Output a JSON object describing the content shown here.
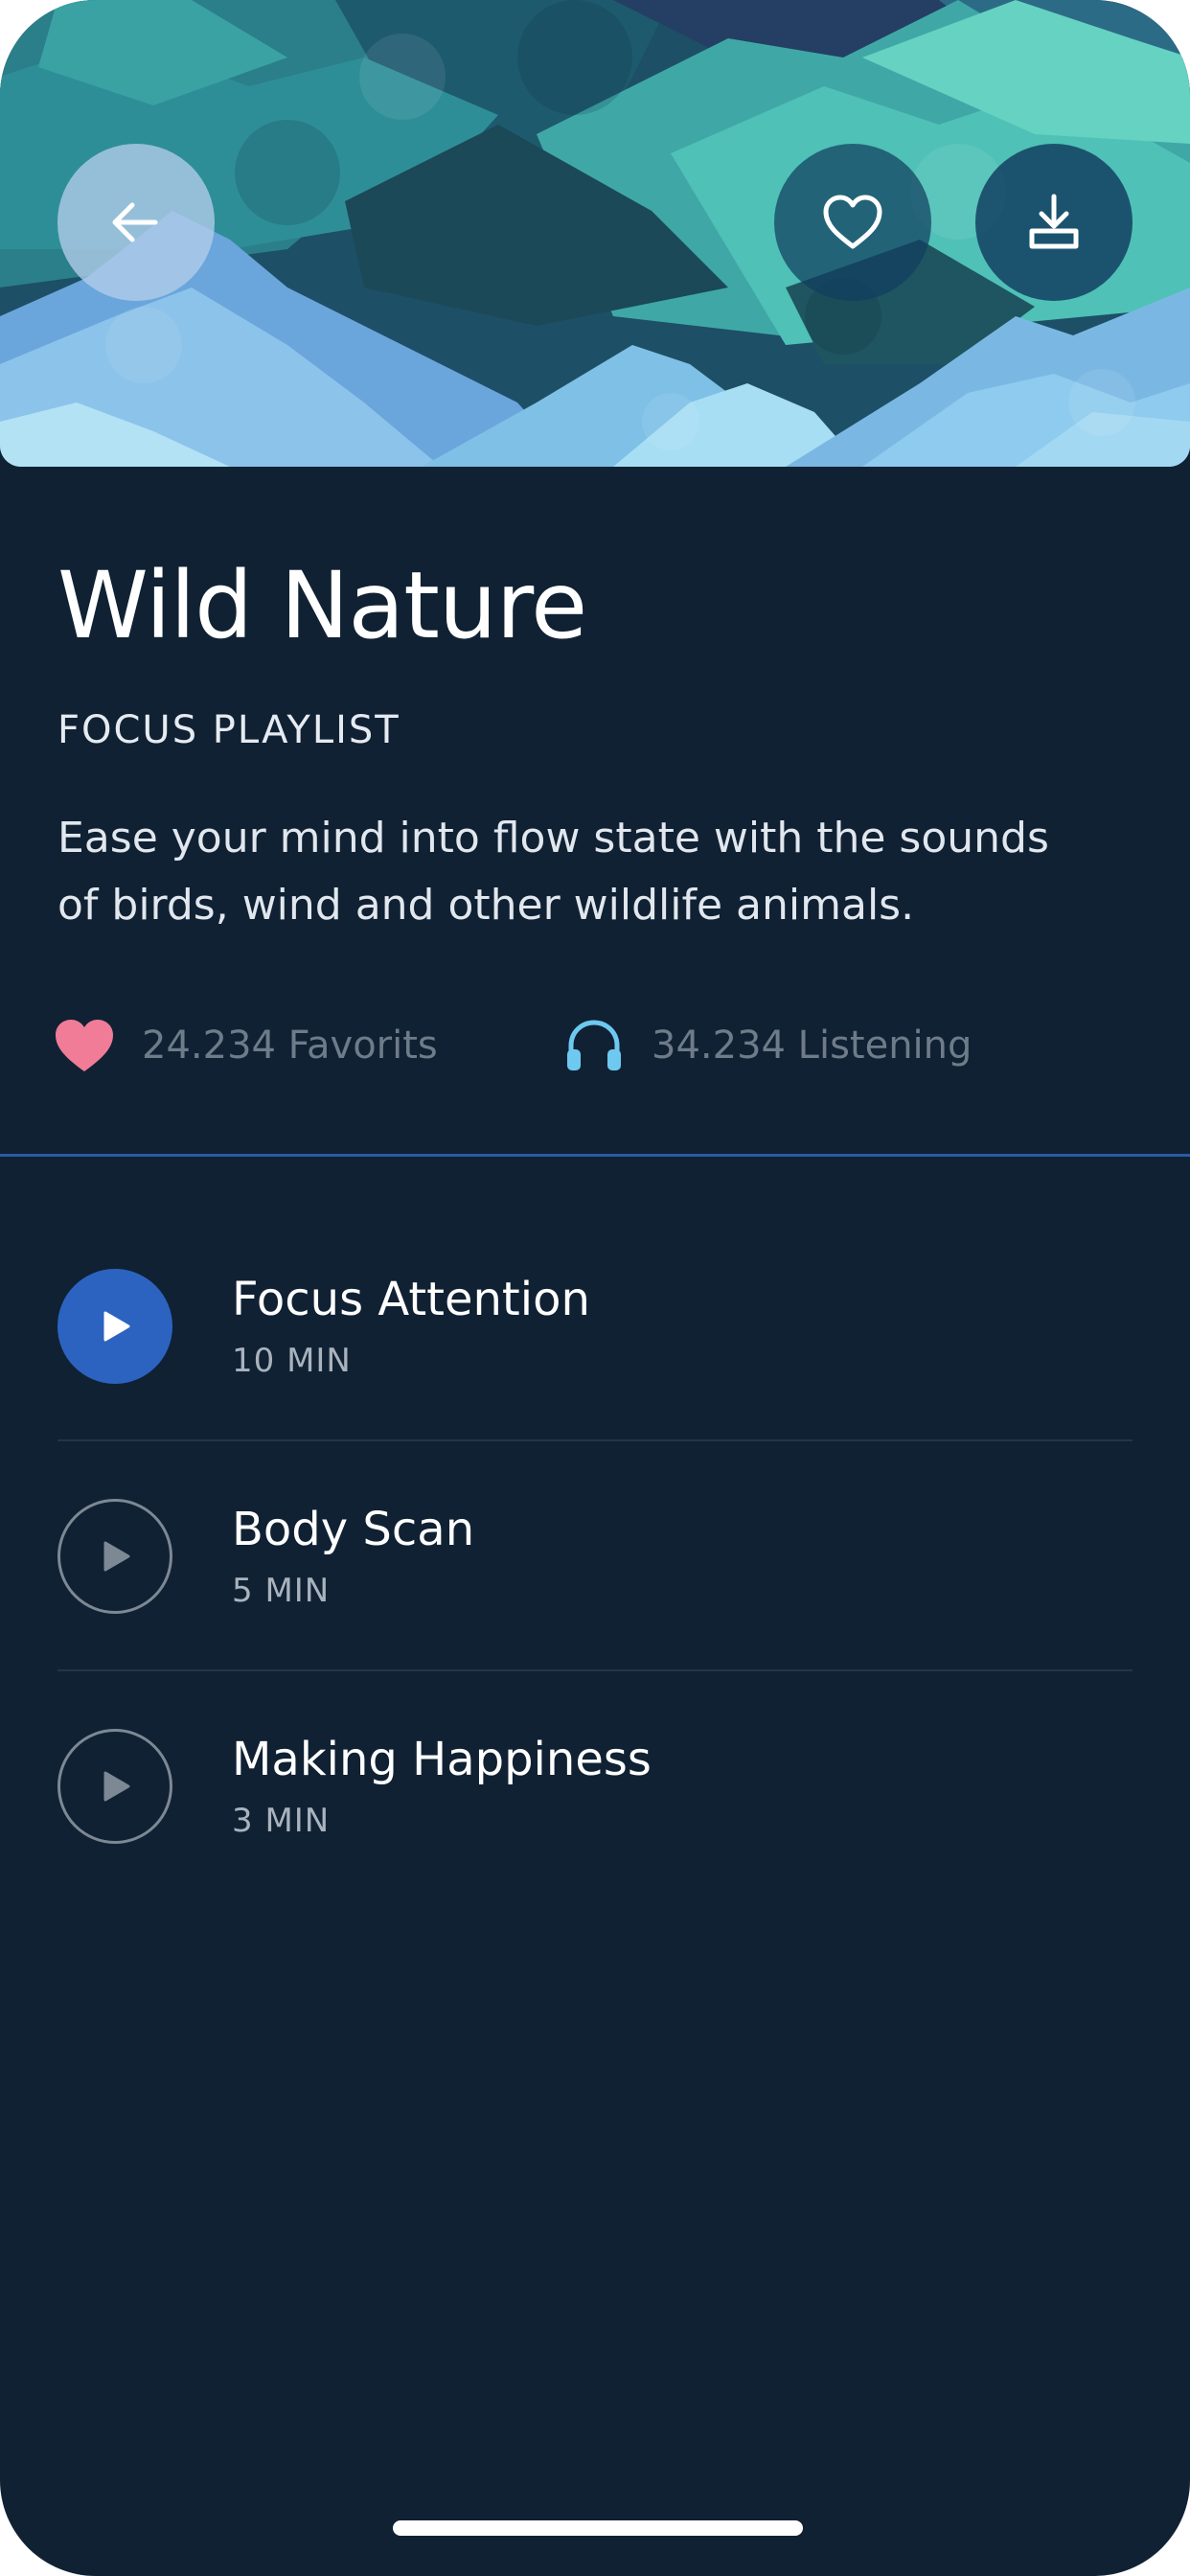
{
  "header": {
    "back_icon": "arrow-left-icon",
    "favorite_icon": "heart-outline-icon",
    "download_icon": "download-icon"
  },
  "playlist": {
    "title": "Wild Nature",
    "category": "FOCUS PLAYLIST",
    "description": "Ease your mind into flow state with the sounds of birds, wind and other wildlife animals."
  },
  "stats": {
    "favorites": {
      "icon": "heart-icon",
      "text": "24.234 Favorits"
    },
    "listening": {
      "icon": "headphones-icon",
      "text": "34.234 Listening"
    }
  },
  "tracks": [
    {
      "title": "Focus Attention",
      "duration": "10 MIN",
      "active": true
    },
    {
      "title": "Body Scan",
      "duration": "5 MIN",
      "active": false
    },
    {
      "title": "Making Happiness",
      "duration": "3 MIN",
      "active": false
    }
  ],
  "colors": {
    "background": "#102133",
    "accent": "#2c63c0",
    "heart": "#f17c98",
    "headphones": "#6ec9f0"
  }
}
